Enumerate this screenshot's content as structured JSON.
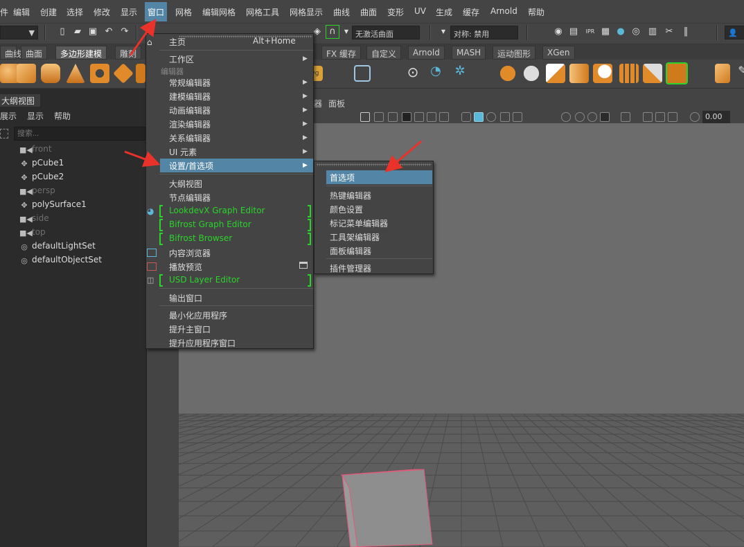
{
  "menubar": {
    "items": [
      "件",
      "编辑",
      "创建",
      "选择",
      "修改",
      "显示",
      "窗口",
      "网格",
      "编辑网格",
      "网格工具",
      "网格显示",
      "曲线",
      "曲面",
      "变形",
      "UV",
      "生成",
      "缓存",
      "Arnold",
      "帮助"
    ]
  },
  "status": {
    "no_live_surface": "无激活曲面",
    "symmetry": "对称: 禁用"
  },
  "shelf_tabs": [
    "曲线",
    "曲面",
    "多边形建模",
    "雕刻",
    "FX 缓存",
    "自定义",
    "Arnold",
    "MASH",
    "运动图形",
    "XGen"
  ],
  "outliner": {
    "tab": "大纲视图",
    "menu": [
      "展示",
      "显示",
      "帮助"
    ],
    "search_placeholder": "搜索...",
    "items": [
      {
        "label": "front",
        "dim": true
      },
      {
        "label": "pCube1",
        "dim": false
      },
      {
        "label": "pCube2",
        "dim": false
      },
      {
        "label": "persp",
        "dim": true
      },
      {
        "label": "polySurface1",
        "dim": false
      },
      {
        "label": "side",
        "dim": true
      },
      {
        "label": "top",
        "dim": true
      },
      {
        "label": "defaultLightSet",
        "dim": false
      },
      {
        "label": "defaultObjectSet",
        "dim": false
      }
    ]
  },
  "viewport": {
    "menu": [
      "器",
      "面板"
    ],
    "value": "0.00"
  },
  "window_menu": {
    "home": "主页",
    "home_shortcut": "Alt+Home",
    "workspaces": "工作区",
    "editors_section": "编辑器",
    "general_editors": "常规编辑器",
    "modeling_editors": "建模编辑器",
    "animation_editors": "动画编辑器",
    "rendering_editors": "渲染编辑器",
    "relationship_editors": "关系编辑器",
    "ui_elements": "UI 元素",
    "settings_prefs": "设置/首选项",
    "outliner": "大纲视图",
    "node_editor": "节点编辑器",
    "lookdevx": "LookdevX Graph Editor",
    "bifrost_graph": "Bifrost Graph Editor",
    "bifrost_browser": "Bifrost Browser",
    "content_browser": "内容浏览器",
    "playblast": "播放预览",
    "usd_layer": "USD Layer Editor",
    "output_window": "输出窗口",
    "minimize_app": "最小化应用程序",
    "raise_main": "提升主窗口",
    "raise_app": "提升应用程序窗口"
  },
  "settings_submenu": {
    "preferences": "首选项",
    "hotkey_editor": "热键编辑器",
    "color_settings": "颜色设置",
    "marking_menu_editor": "标记菜单编辑器",
    "shelf_editor": "工具架编辑器",
    "panel_editor": "面板编辑器",
    "plugin_manager": "插件管理器"
  },
  "colors": {
    "highlight": "#5285a6",
    "green": "#2bd42b",
    "arrow": "#e8322a"
  }
}
